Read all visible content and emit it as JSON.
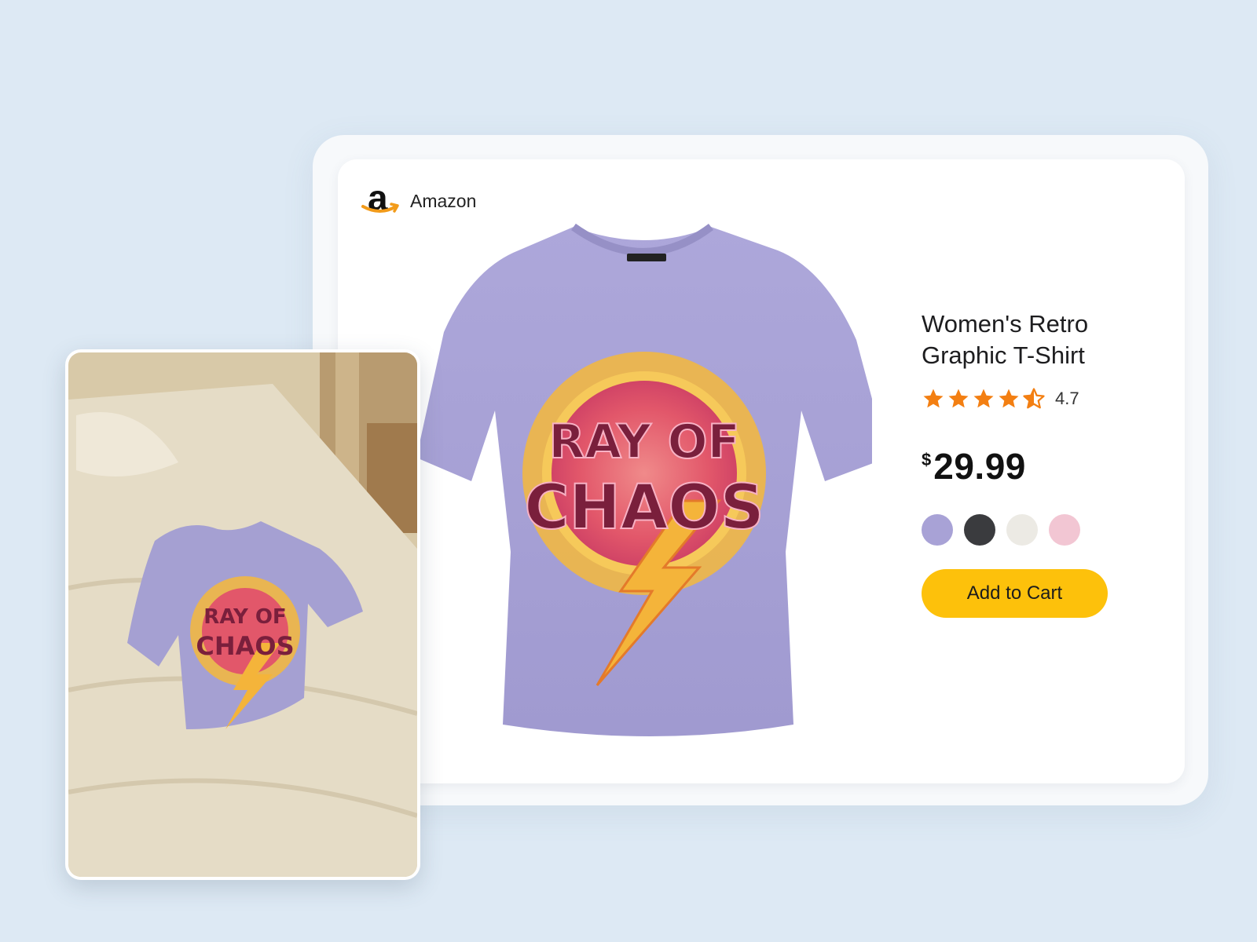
{
  "brand": {
    "name": "Amazon",
    "logo_letter": "a",
    "logo_icon": "amazon-smile-icon"
  },
  "product": {
    "title": "Women's Retro Graphic T-Shirt",
    "rating": {
      "value": "4.7",
      "stars": 4.5,
      "icon": "star-icon",
      "color": "#f37f12"
    },
    "price": {
      "currency": "$",
      "amount": "29.99"
    },
    "shirt_color": "#a8a2d6",
    "graphic_text": [
      "RAY OF",
      "CHAOS"
    ],
    "color_options": [
      {
        "name": "lavender",
        "hex": "#a8a2d6"
      },
      {
        "name": "charcoal",
        "hex": "#3a3b3e"
      },
      {
        "name": "cream",
        "hex": "#eceae4"
      },
      {
        "name": "pink",
        "hex": "#f2c6d3"
      }
    ],
    "cta": {
      "label": "Add to Cart",
      "color": "#fdc10b"
    }
  },
  "photo": {
    "subject": "t-shirt-on-bed-photo",
    "bedding_color": "#e4dac3"
  }
}
